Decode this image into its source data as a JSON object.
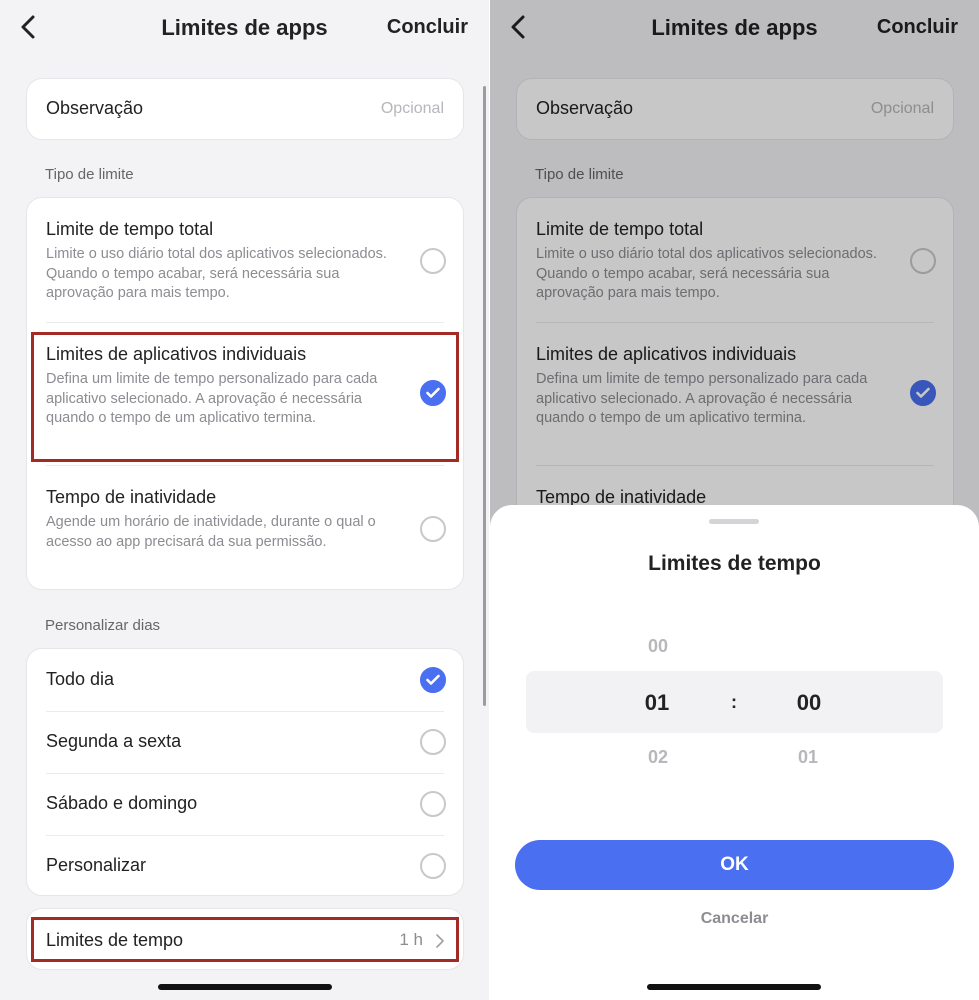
{
  "header": {
    "title": "Limites de apps",
    "done_label": "Concluir"
  },
  "note": {
    "label": "Observação",
    "placeholder": "Opcional"
  },
  "limit_type": {
    "section_label": "Tipo de limite",
    "options": [
      {
        "title": "Limite de tempo total",
        "description": "Limite o uso diário total dos aplicativos selecionados. Quando o tempo acabar, será necessária sua aprovação para mais tempo.",
        "selected": false
      },
      {
        "title": "Limites de aplicativos individuais",
        "description": "Defina um limite de tempo personalizado para cada aplicativo selecionado. A aprovação é necessária quando o tempo de um aplicativo termina.",
        "selected": true
      },
      {
        "title": "Tempo de inatividade",
        "description": "Agende um horário de inatividade, durante o qual o acesso ao app precisará da sua permissão.",
        "selected": false
      }
    ]
  },
  "days": {
    "section_label": "Personalizar dias",
    "options": [
      {
        "label": "Todo dia",
        "selected": true
      },
      {
        "label": "Segunda a sexta",
        "selected": false
      },
      {
        "label": "Sábado e domingo",
        "selected": false
      },
      {
        "label": "Personalizar",
        "selected": false
      }
    ]
  },
  "time_limits": {
    "label": "Limites de tempo",
    "value": "1 h"
  },
  "sheet": {
    "title": "Limites de tempo",
    "hours": {
      "above": "00",
      "selected": "01",
      "below": "02"
    },
    "separator": ":",
    "minutes": {
      "above": "",
      "selected": "00",
      "below": "01"
    },
    "ok_label": "OK",
    "cancel_label": "Cancelar"
  },
  "colors": {
    "accent": "#4a6ff0",
    "highlight": "#a32a25",
    "background": "#f3f3f5"
  }
}
